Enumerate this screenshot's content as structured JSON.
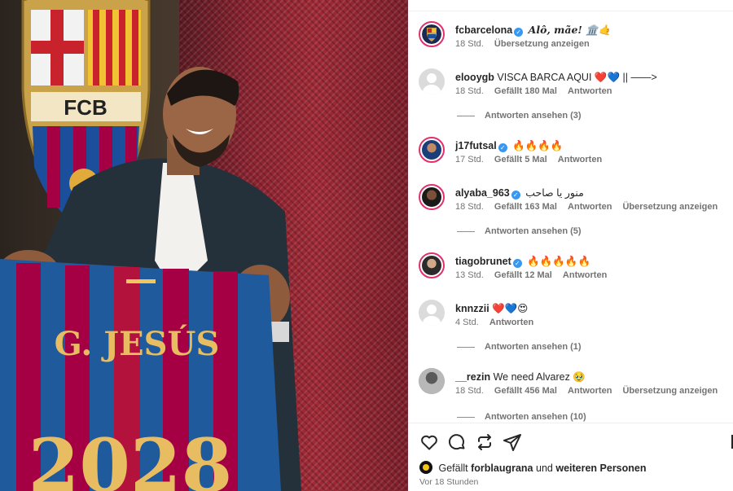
{
  "post": {
    "image_alt": "Player holding FC Barcelona jersey",
    "crest_text": "FCB",
    "jersey_name": "G. JESÚS",
    "jersey_number": "2028"
  },
  "comments": [
    {
      "user": "fcbarcelona",
      "verified": true,
      "text": "Alô, mãe! 🏛️🤙",
      "time": "18 Std.",
      "actions": [
        "Übersetzung anzeigen"
      ],
      "likes": "",
      "avatar": "fcb"
    },
    {
      "user": "elooygb",
      "verified": false,
      "text": "VISCA BARCA AQUI ❤️💙 || ——>",
      "time": "18 Std.",
      "likes": "Gefällt 180 Mal",
      "actions": [
        "Antworten"
      ],
      "replies": "Antworten ansehen (3)",
      "avatar": "placeholder"
    },
    {
      "user": "j17futsal",
      "verified": true,
      "text": "🔥🔥🔥🔥",
      "time": "17 Std.",
      "likes": "Gefällt 5 Mal",
      "actions": [
        "Antworten"
      ],
      "avatar": "photo"
    },
    {
      "user": "alyaba_963",
      "verified": true,
      "text": "منور يا صاحب",
      "time": "18 Std.",
      "likes": "Gefällt 163 Mal",
      "actions": [
        "Antworten",
        "Übersetzung anzeigen"
      ],
      "replies": "Antworten ansehen (5)",
      "avatar": "photo"
    },
    {
      "user": "tiagobrunet",
      "verified": true,
      "text": "🔥🔥🔥🔥🔥",
      "time": "13 Std.",
      "likes": "Gefällt 12 Mal",
      "actions": [
        "Antworten"
      ],
      "avatar": "photo"
    },
    {
      "user": "knnzzii",
      "verified": false,
      "text": "❤️💙😍",
      "time": "4 Std.",
      "likes": "",
      "actions": [
        "Antworten"
      ],
      "replies": "Antworten ansehen (1)",
      "avatar": "placeholder"
    },
    {
      "user": "__rezin",
      "verified": false,
      "text": "We need Alvarez 🥹",
      "time": "18 Std.",
      "likes": "Gefällt 456 Mal",
      "actions": [
        "Antworten",
        "Übersetzung anzeigen"
      ],
      "replies": "Antworten ansehen (10)",
      "avatar": "photo-gray"
    }
  ],
  "footer": {
    "icons": [
      "heart-icon",
      "comment-icon",
      "repost-icon",
      "share-icon"
    ],
    "likes_prefix": "Gefällt",
    "likes_user": "forblaugrana",
    "likes_mid": "und",
    "likes_suffix": "weiteren Personen",
    "time": "Vor 18 Stunden"
  },
  "colors": {
    "verified": "#3897f0",
    "meta": "#737373",
    "ring": "#e1306c",
    "barca_blue": "#1b4f9c",
    "barca_red": "#a50044"
  }
}
